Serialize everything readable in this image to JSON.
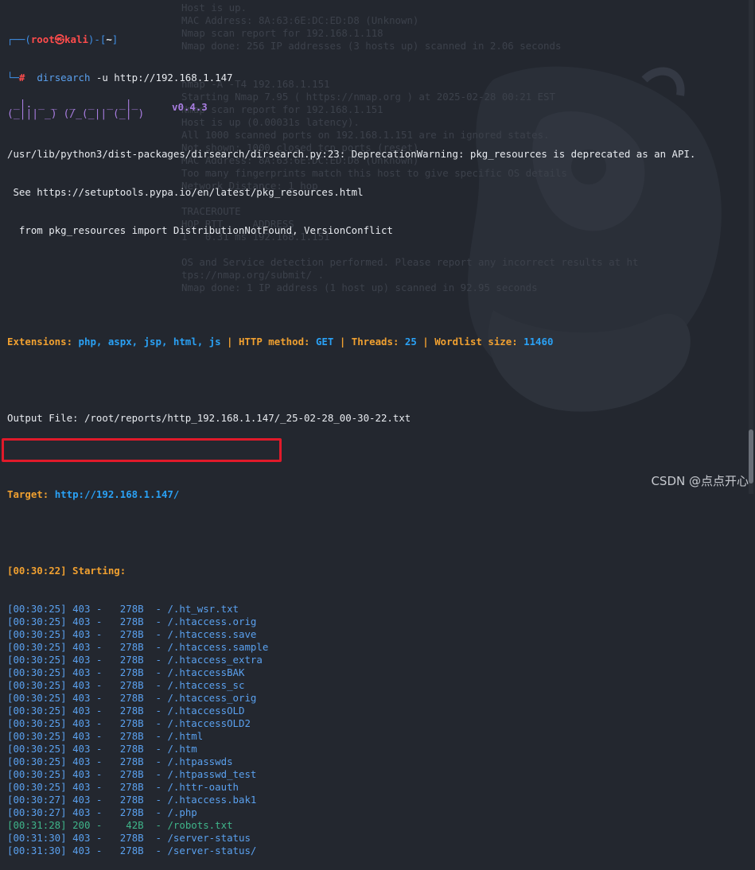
{
  "prompt": {
    "open": "┌──(",
    "user": "root",
    "at": "㉿",
    "host": "kali",
    "mid": ")-[",
    "dir": "~",
    "close": "]",
    "line2_prefix": "└─",
    "hash": "#",
    "command": "dirsearch",
    "args": " -u http://192.168.1.147"
  },
  "warning_lines": [
    "/usr/lib/python3/dist-packages/dirsearch/dirsearch.py:23: DeprecationWarning: pkg_resources is deprecated as an API.",
    " See https://setuptools.pypa.io/en/latest/pkg_resources.html",
    "  from pkg_resources import DistributionNotFound, VersionConflict"
  ],
  "banner": {
    "version": "v0.4.3"
  },
  "config": {
    "extensions_label": "Extensions:",
    "extensions_value": "php, aspx, jsp, html, js",
    "method_label": "HTTP method:",
    "method_value": "GET",
    "threads_label": "Threads:",
    "threads_value": "25",
    "wordlist_label": "Wordlist size:",
    "wordlist_value": "11460"
  },
  "output_file": "Output File: /root/reports/http_192.168.1.147/_25-02-28_00-30-22.txt",
  "target_label": "Target:",
  "target_value": "http://192.168.1.147/",
  "starting": "[00:30:22] Starting:",
  "results": [
    {
      "time": "[00:30:25]",
      "status": "403",
      "size": "278B",
      "path": "/.ht_wsr.txt"
    },
    {
      "time": "[00:30:25]",
      "status": "403",
      "size": "278B",
      "path": "/.htaccess.orig"
    },
    {
      "time": "[00:30:25]",
      "status": "403",
      "size": "278B",
      "path": "/.htaccess.save"
    },
    {
      "time": "[00:30:25]",
      "status": "403",
      "size": "278B",
      "path": "/.htaccess.sample"
    },
    {
      "time": "[00:30:25]",
      "status": "403",
      "size": "278B",
      "path": "/.htaccess_extra"
    },
    {
      "time": "[00:30:25]",
      "status": "403",
      "size": "278B",
      "path": "/.htaccessBAK"
    },
    {
      "time": "[00:30:25]",
      "status": "403",
      "size": "278B",
      "path": "/.htaccess_sc"
    },
    {
      "time": "[00:30:25]",
      "status": "403",
      "size": "278B",
      "path": "/.htaccess_orig"
    },
    {
      "time": "[00:30:25]",
      "status": "403",
      "size": "278B",
      "path": "/.htaccessOLD"
    },
    {
      "time": "[00:30:25]",
      "status": "403",
      "size": "278B",
      "path": "/.htaccessOLD2"
    },
    {
      "time": "[00:30:25]",
      "status": "403",
      "size": "278B",
      "path": "/.html"
    },
    {
      "time": "[00:30:25]",
      "status": "403",
      "size": "278B",
      "path": "/.htm"
    },
    {
      "time": "[00:30:25]",
      "status": "403",
      "size": "278B",
      "path": "/.htpasswds"
    },
    {
      "time": "[00:30:25]",
      "status": "403",
      "size": "278B",
      "path": "/.htpasswd_test"
    },
    {
      "time": "[00:30:25]",
      "status": "403",
      "size": "278B",
      "path": "/.httr-oauth"
    },
    {
      "time": "[00:30:27]",
      "status": "403",
      "size": "278B",
      "path": "/.htaccess.bak1"
    },
    {
      "time": "[00:30:27]",
      "status": "403",
      "size": "278B",
      "path": "/.php"
    },
    {
      "time": "[00:31:28]",
      "status": "200",
      "size": " 42B",
      "path": "/robots.txt"
    },
    {
      "time": "[00:31:30]",
      "status": "403",
      "size": "278B",
      "path": "/server-status"
    },
    {
      "time": "[00:31:30]",
      "status": "403",
      "size": "278B",
      "path": "/server-status/"
    }
  ],
  "ghost_text": [
    "Host is up.",
    "MAC Address: 8A:63:6E:DC:ED:D8 (Unknown)",
    "Nmap scan report for 192.168.1.118",
    "Nmap done: 256 IP addresses (3 hosts up) scanned in 2.06 seconds",
    "",
    "",
    "nmap -A -T4 192.168.1.151",
    "Starting Nmap 7.95 ( https://nmap.org ) at 2025-02-28 00:21 EST",
    "Nmap scan report for 192.168.1.151",
    "Host is up (0.00031s latency).",
    "All 1000 scanned ports on 192.168.1.151 are in ignored states.",
    "Not shown: 1000 closed tcp ports (reset)",
    "MAC Address: 8A:63:6E:DC:ED:D8 (Unknown)",
    "Too many fingerprints match this host to give specific OS details",
    "Network Distance: 1 hop",
    "",
    "TRACEROUTE",
    "HOP RTT     ADDRESS",
    "1   0.31 ms 192.168.1.151",
    "",
    "OS and Service detection performed. Please report any incorrect results at ht",
    "tps://nmap.org/submit/ .",
    "Nmap done: 1 IP address (1 host up) scanned in 92.95 seconds"
  ],
  "watermark": "CSDN @点点开心",
  "colors": {
    "background": "#23272f",
    "prompt_blue": "#3f8fe6",
    "root_red": "#ff4c4c",
    "orange": "#f0a030",
    "cyan": "#2aa1f5",
    "success_green": "#3fb58a",
    "highlight_red": "#e01a2a"
  }
}
